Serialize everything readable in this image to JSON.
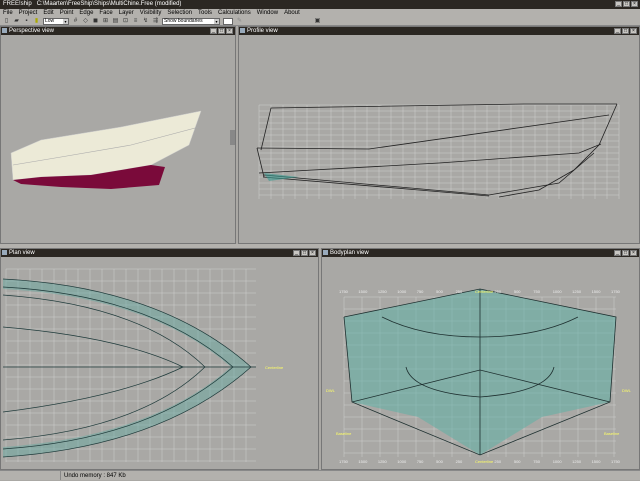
{
  "window": {
    "app": "FREE!ship",
    "path": "C:\\Maarten\\FreeShip\\Ships\\MultiChine.Free (modified)"
  },
  "menu": [
    "File",
    "Project",
    "Edit",
    "Point",
    "Edge",
    "Face",
    "Layer",
    "Visibility",
    "Selection",
    "Tools",
    "Calculations",
    "Window",
    "About"
  ],
  "toolbar": {
    "precision": "Low",
    "view_mode": "Show boundaries"
  },
  "panels": {
    "perspective": "Perspective view",
    "profile": "Profile view",
    "plan": "Plan view",
    "bodyplan": "Bodyplan view"
  },
  "bodyplan": {
    "ticks": [
      "1750",
      "1500",
      "1250",
      "1000",
      "750",
      "500",
      "250",
      "Centerline",
      "250",
      "500",
      "750",
      "1000",
      "1250",
      "1500",
      "1750"
    ],
    "baseline": "Baseline",
    "dwl": "DWL"
  },
  "plan": {
    "centerline": "Centerline"
  },
  "status": {
    "undo": "Undo memory : 847 Kb"
  },
  "colors": {
    "hull_top": "#ecead7",
    "hull_bottom": "#7a0a3a",
    "mesh": "#3a9a90",
    "grid": "#d8d8d8"
  }
}
